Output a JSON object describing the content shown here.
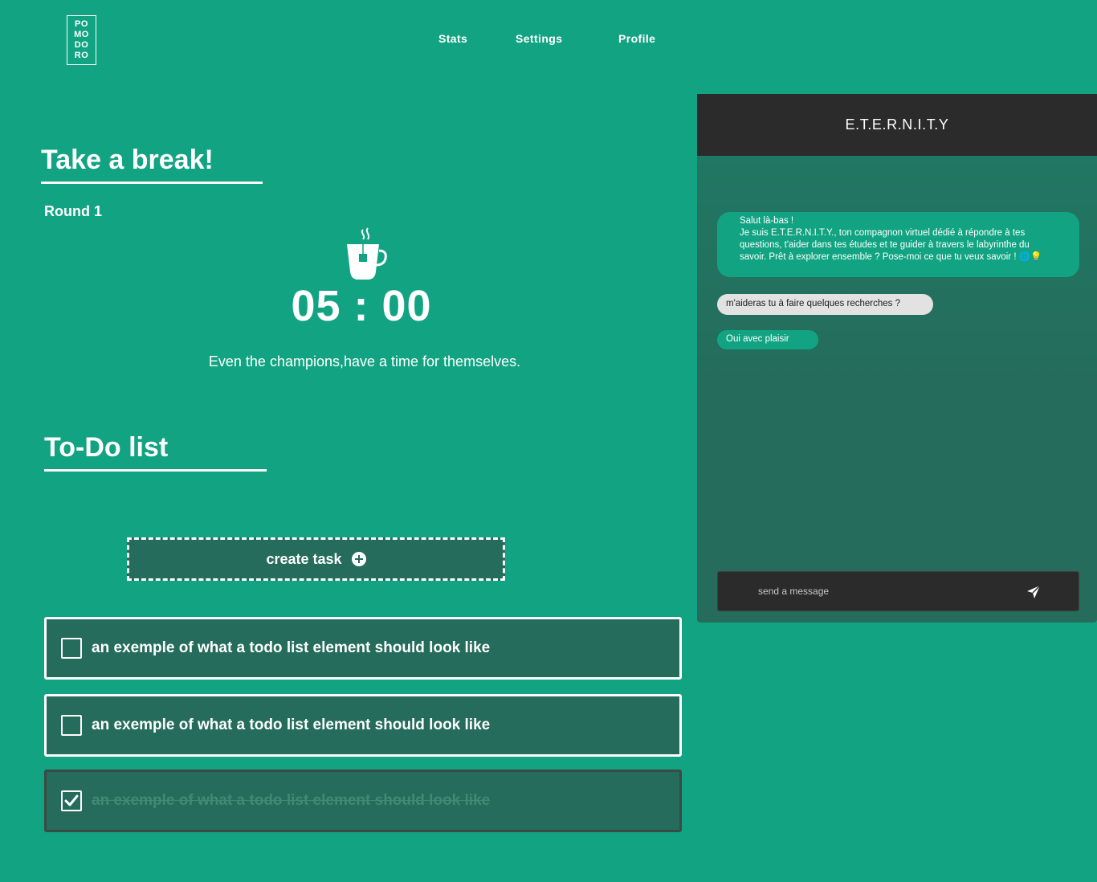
{
  "logo": {
    "lines": [
      "PO",
      "MO",
      "DO",
      "RO"
    ]
  },
  "nav": {
    "items": [
      "Stats",
      "Settings",
      "Profile"
    ]
  },
  "timer": {
    "heading": "Take a break!",
    "round": "Round 1",
    "time": "05 : 00",
    "quote": "Even the champions,have a time for themselves."
  },
  "todo": {
    "heading": "To-Do list",
    "create_label": "create task",
    "items": [
      {
        "text": "an exemple of what a todo list element should look like",
        "checked": false
      },
      {
        "text": "an exemple of what a todo list element should look like",
        "checked": false
      },
      {
        "text": "an exemple of what a todo list element should look like",
        "checked": true
      }
    ]
  },
  "chat": {
    "title": "E.T.E.R.N.I.T.Y",
    "messages": [
      {
        "from": "bot",
        "lines": [
          "Salut là-bas !",
          "Je suis E.T.E.R.N.I.T.Y., ton compagnon virtuel dédié à répondre à tes questions, t'aider dans tes études et te guider à travers le labyrinthe du savoir. Prêt à explorer ensemble ? Pose-moi ce que tu veux savoir ! 🌐💡"
        ]
      },
      {
        "from": "user",
        "text": "m'aideras tu à faire quelques recherches ?"
      },
      {
        "from": "bot",
        "text": "Oui avec plaisir"
      }
    ],
    "input_placeholder": "send a message"
  },
  "colors": {
    "background": "#12a482",
    "card": "#256c5c",
    "chat_header": "#2b2b2b",
    "user_bubble": "#e2e2e2"
  }
}
